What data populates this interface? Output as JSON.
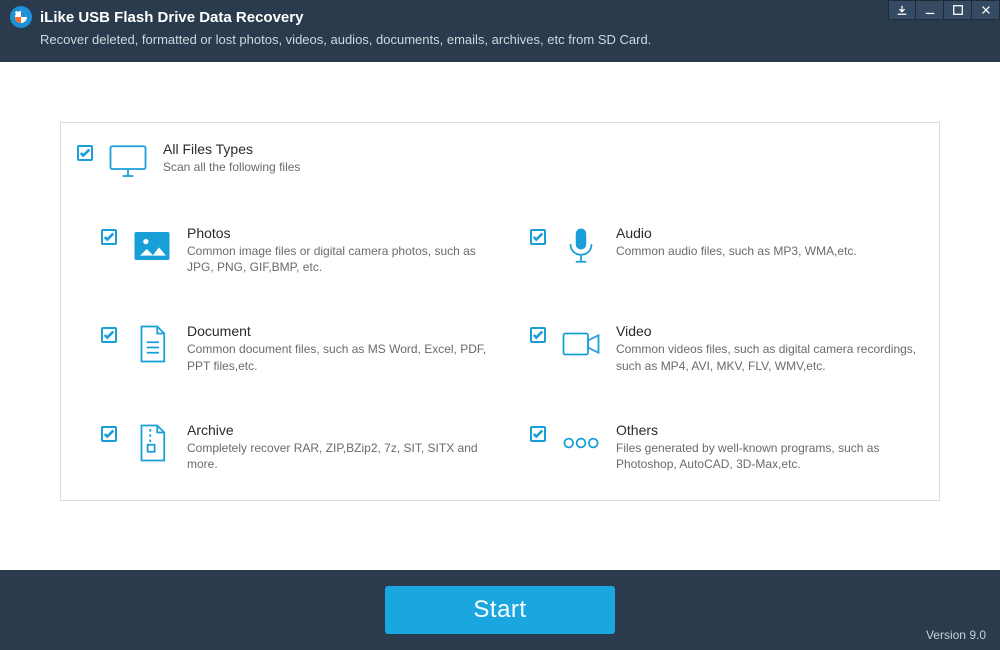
{
  "header": {
    "title": "iLike USB Flash Drive Data Recovery",
    "subtitle": "Recover deleted, formatted or lost photos, videos, audios, documents, emails, archives, etc from SD Card."
  },
  "allTypes": {
    "title": "All Files Types",
    "desc": "Scan all the following files"
  },
  "types": [
    {
      "key": "photos",
      "title": "Photos",
      "desc": "Common image files or digital camera photos, such as JPG, PNG, GIF,BMP, etc."
    },
    {
      "key": "audio",
      "title": "Audio",
      "desc": "Common audio files, such as MP3, WMA,etc."
    },
    {
      "key": "document",
      "title": "Document",
      "desc": "Common document files, such as MS Word, Excel, PDF, PPT files,etc."
    },
    {
      "key": "video",
      "title": "Video",
      "desc": "Common videos files, such as digital camera recordings, such as MP4, AVI, MKV, FLV, WMV,etc."
    },
    {
      "key": "archive",
      "title": "Archive",
      "desc": "Completely recover RAR, ZIP,BZip2, 7z, SIT, SITX and more."
    },
    {
      "key": "others",
      "title": "Others",
      "desc": "Files generated by well-known programs, such as Photoshop, AutoCAD, 3D-Max,etc."
    }
  ],
  "actions": {
    "start": "Start"
  },
  "footer": {
    "version": "Version 9.0"
  }
}
